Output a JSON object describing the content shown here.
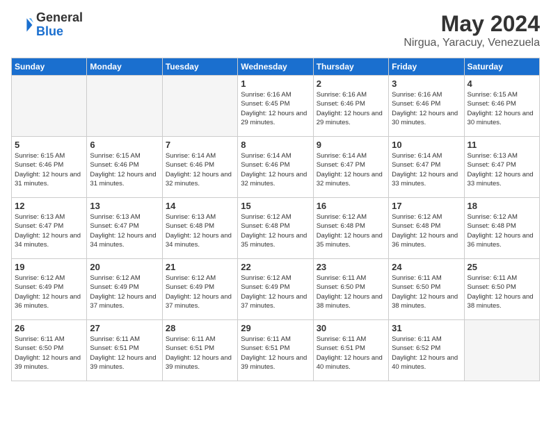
{
  "logo": {
    "general": "General",
    "blue": "Blue"
  },
  "title": "May 2024",
  "subtitle": "Nirgua, Yaracuy, Venezuela",
  "days_header": [
    "Sunday",
    "Monday",
    "Tuesday",
    "Wednesday",
    "Thursday",
    "Friday",
    "Saturday"
  ],
  "weeks": [
    [
      {
        "day": "",
        "info": ""
      },
      {
        "day": "",
        "info": ""
      },
      {
        "day": "",
        "info": ""
      },
      {
        "day": "1",
        "info": "Sunrise: 6:16 AM\nSunset: 6:45 PM\nDaylight: 12 hours and 29 minutes."
      },
      {
        "day": "2",
        "info": "Sunrise: 6:16 AM\nSunset: 6:46 PM\nDaylight: 12 hours and 29 minutes."
      },
      {
        "day": "3",
        "info": "Sunrise: 6:16 AM\nSunset: 6:46 PM\nDaylight: 12 hours and 30 minutes."
      },
      {
        "day": "4",
        "info": "Sunrise: 6:15 AM\nSunset: 6:46 PM\nDaylight: 12 hours and 30 minutes."
      }
    ],
    [
      {
        "day": "5",
        "info": "Sunrise: 6:15 AM\nSunset: 6:46 PM\nDaylight: 12 hours and 31 minutes."
      },
      {
        "day": "6",
        "info": "Sunrise: 6:15 AM\nSunset: 6:46 PM\nDaylight: 12 hours and 31 minutes."
      },
      {
        "day": "7",
        "info": "Sunrise: 6:14 AM\nSunset: 6:46 PM\nDaylight: 12 hours and 32 minutes."
      },
      {
        "day": "8",
        "info": "Sunrise: 6:14 AM\nSunset: 6:46 PM\nDaylight: 12 hours and 32 minutes."
      },
      {
        "day": "9",
        "info": "Sunrise: 6:14 AM\nSunset: 6:47 PM\nDaylight: 12 hours and 32 minutes."
      },
      {
        "day": "10",
        "info": "Sunrise: 6:14 AM\nSunset: 6:47 PM\nDaylight: 12 hours and 33 minutes."
      },
      {
        "day": "11",
        "info": "Sunrise: 6:13 AM\nSunset: 6:47 PM\nDaylight: 12 hours and 33 minutes."
      }
    ],
    [
      {
        "day": "12",
        "info": "Sunrise: 6:13 AM\nSunset: 6:47 PM\nDaylight: 12 hours and 34 minutes."
      },
      {
        "day": "13",
        "info": "Sunrise: 6:13 AM\nSunset: 6:47 PM\nDaylight: 12 hours and 34 minutes."
      },
      {
        "day": "14",
        "info": "Sunrise: 6:13 AM\nSunset: 6:48 PM\nDaylight: 12 hours and 34 minutes."
      },
      {
        "day": "15",
        "info": "Sunrise: 6:12 AM\nSunset: 6:48 PM\nDaylight: 12 hours and 35 minutes."
      },
      {
        "day": "16",
        "info": "Sunrise: 6:12 AM\nSunset: 6:48 PM\nDaylight: 12 hours and 35 minutes."
      },
      {
        "day": "17",
        "info": "Sunrise: 6:12 AM\nSunset: 6:48 PM\nDaylight: 12 hours and 36 minutes."
      },
      {
        "day": "18",
        "info": "Sunrise: 6:12 AM\nSunset: 6:48 PM\nDaylight: 12 hours and 36 minutes."
      }
    ],
    [
      {
        "day": "19",
        "info": "Sunrise: 6:12 AM\nSunset: 6:49 PM\nDaylight: 12 hours and 36 minutes."
      },
      {
        "day": "20",
        "info": "Sunrise: 6:12 AM\nSunset: 6:49 PM\nDaylight: 12 hours and 37 minutes."
      },
      {
        "day": "21",
        "info": "Sunrise: 6:12 AM\nSunset: 6:49 PM\nDaylight: 12 hours and 37 minutes."
      },
      {
        "day": "22",
        "info": "Sunrise: 6:12 AM\nSunset: 6:49 PM\nDaylight: 12 hours and 37 minutes."
      },
      {
        "day": "23",
        "info": "Sunrise: 6:11 AM\nSunset: 6:50 PM\nDaylight: 12 hours and 38 minutes."
      },
      {
        "day": "24",
        "info": "Sunrise: 6:11 AM\nSunset: 6:50 PM\nDaylight: 12 hours and 38 minutes."
      },
      {
        "day": "25",
        "info": "Sunrise: 6:11 AM\nSunset: 6:50 PM\nDaylight: 12 hours and 38 minutes."
      }
    ],
    [
      {
        "day": "26",
        "info": "Sunrise: 6:11 AM\nSunset: 6:50 PM\nDaylight: 12 hours and 39 minutes."
      },
      {
        "day": "27",
        "info": "Sunrise: 6:11 AM\nSunset: 6:51 PM\nDaylight: 12 hours and 39 minutes."
      },
      {
        "day": "28",
        "info": "Sunrise: 6:11 AM\nSunset: 6:51 PM\nDaylight: 12 hours and 39 minutes."
      },
      {
        "day": "29",
        "info": "Sunrise: 6:11 AM\nSunset: 6:51 PM\nDaylight: 12 hours and 39 minutes."
      },
      {
        "day": "30",
        "info": "Sunrise: 6:11 AM\nSunset: 6:51 PM\nDaylight: 12 hours and 40 minutes."
      },
      {
        "day": "31",
        "info": "Sunrise: 6:11 AM\nSunset: 6:52 PM\nDaylight: 12 hours and 40 minutes."
      },
      {
        "day": "",
        "info": ""
      }
    ]
  ]
}
